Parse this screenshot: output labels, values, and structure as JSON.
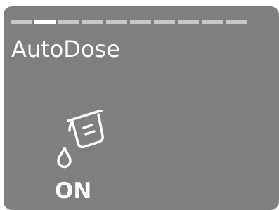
{
  "screen": {
    "background_color": "#7f7f7f",
    "accent_color": "#ffffff",
    "inactive_segment_color": "#c8c8c8",
    "progress": {
      "total_segments": 10,
      "active_segment": 2
    },
    "title": "AutoDose",
    "icon": "autodose-dispenser-icon",
    "status": "ON"
  }
}
